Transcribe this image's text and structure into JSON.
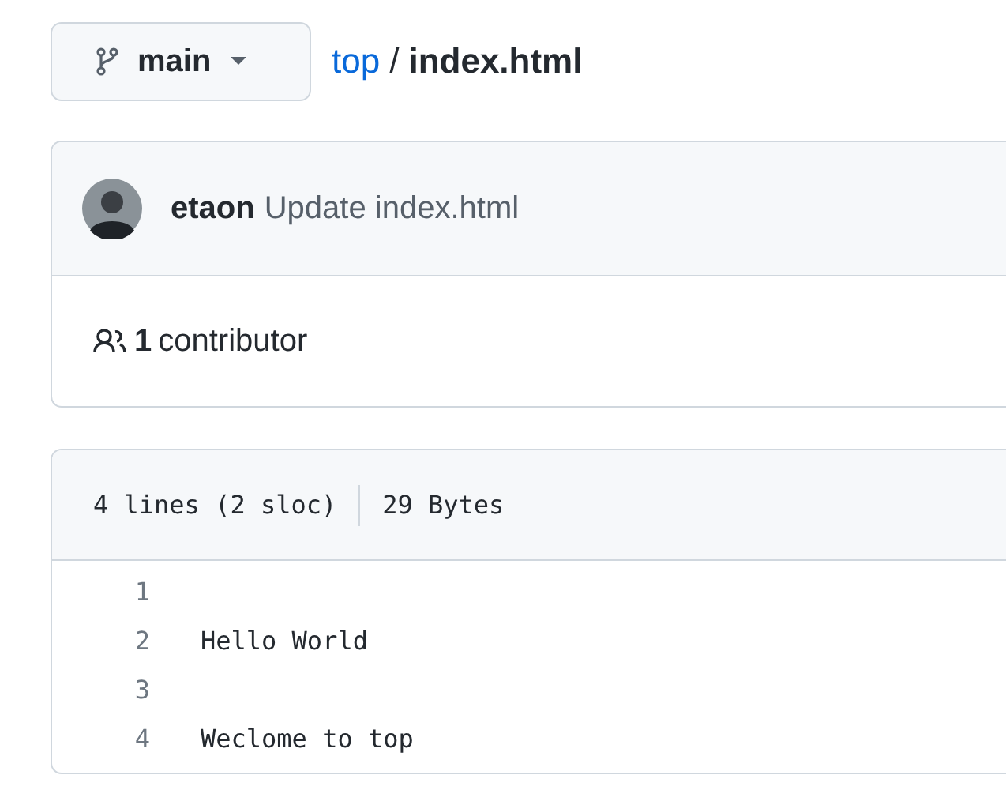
{
  "branch": {
    "name": "main"
  },
  "breadcrumb": {
    "repo": "top",
    "separator": "/",
    "file": "index.html"
  },
  "commit": {
    "author": "etaon",
    "message": "Update index.html"
  },
  "contributors": {
    "count": "1",
    "label": "contributor"
  },
  "file_info": {
    "lines": "4 lines (2 sloc)",
    "size": "29 Bytes"
  },
  "code_lines": [
    {
      "number": "1"
    },
    {
      "number": "2",
      "text": "Hello World"
    },
    {
      "number": "3"
    },
    {
      "number": "4",
      "text": "Weclome to top"
    }
  ]
}
